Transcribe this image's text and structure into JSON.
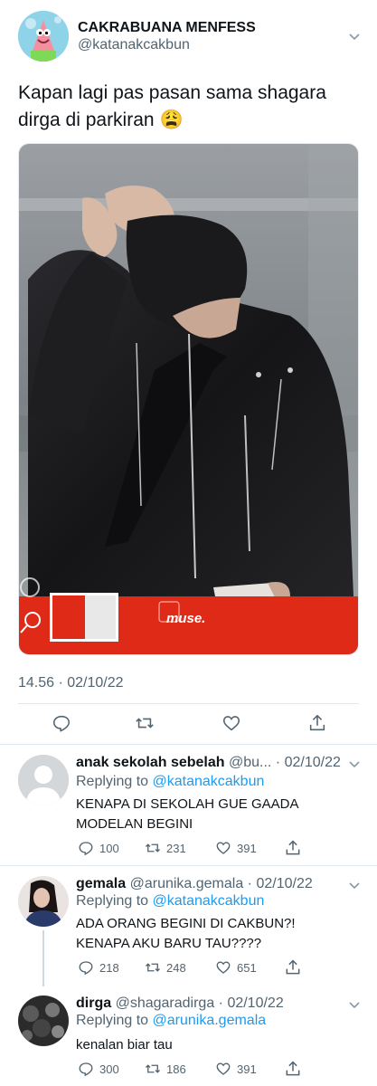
{
  "main_tweet": {
    "display_name": "CAKRABUANA MENFESS",
    "handle": "@katanakcakbun",
    "text_line1": "Kapan lagi pas pasan sama shagara",
    "text_line2": "dirga di parkiran",
    "emoji": "😩",
    "media": {
      "watermark": "muse.",
      "colors": {
        "background": "#8a8f93",
        "jacket": "#1b1b1d",
        "banner": "#e02a18"
      }
    },
    "timestamp": "14.56 · 02/10/22",
    "actions": [
      "reply-icon",
      "retweet-icon",
      "like-icon",
      "share-icon"
    ]
  },
  "replies": [
    {
      "display_name": "anak sekolah sebelah",
      "handle_date": "@bu... · 02/10/22",
      "replying_prefix": "Replying to",
      "replying_to": "@katanakcakbun",
      "text_line1": "KENAPA DI SEKOLAH GUE GAADA",
      "text_line2": "MODELAN BEGINI",
      "replies": "100",
      "retweets": "231",
      "likes": "391"
    },
    {
      "display_name": "gemala",
      "handle_date": "@arunika.gemala · 02/10/22",
      "replying_prefix": "Replying to",
      "replying_to": "@katanakcakbun",
      "text_line1": "ADA ORANG BEGINI DI CAKBUN?!",
      "text_line2": "KENAPA AKU BARU TAU????",
      "replies": "218",
      "retweets": "248",
      "likes": "651"
    },
    {
      "display_name": "dirga",
      "handle_date": "@shagaradirga · 02/10/22",
      "replying_prefix": "Replying to",
      "replying_to": "@arunika.gemala",
      "text_line1": "kenalan biar tau",
      "replies": "300",
      "retweets": "186",
      "likes": "391"
    }
  ],
  "colors": {
    "link": "#1d9bf0",
    "secondary_text": "#536471",
    "primary_text": "#0f1419",
    "divider": "#e1e8ed"
  }
}
